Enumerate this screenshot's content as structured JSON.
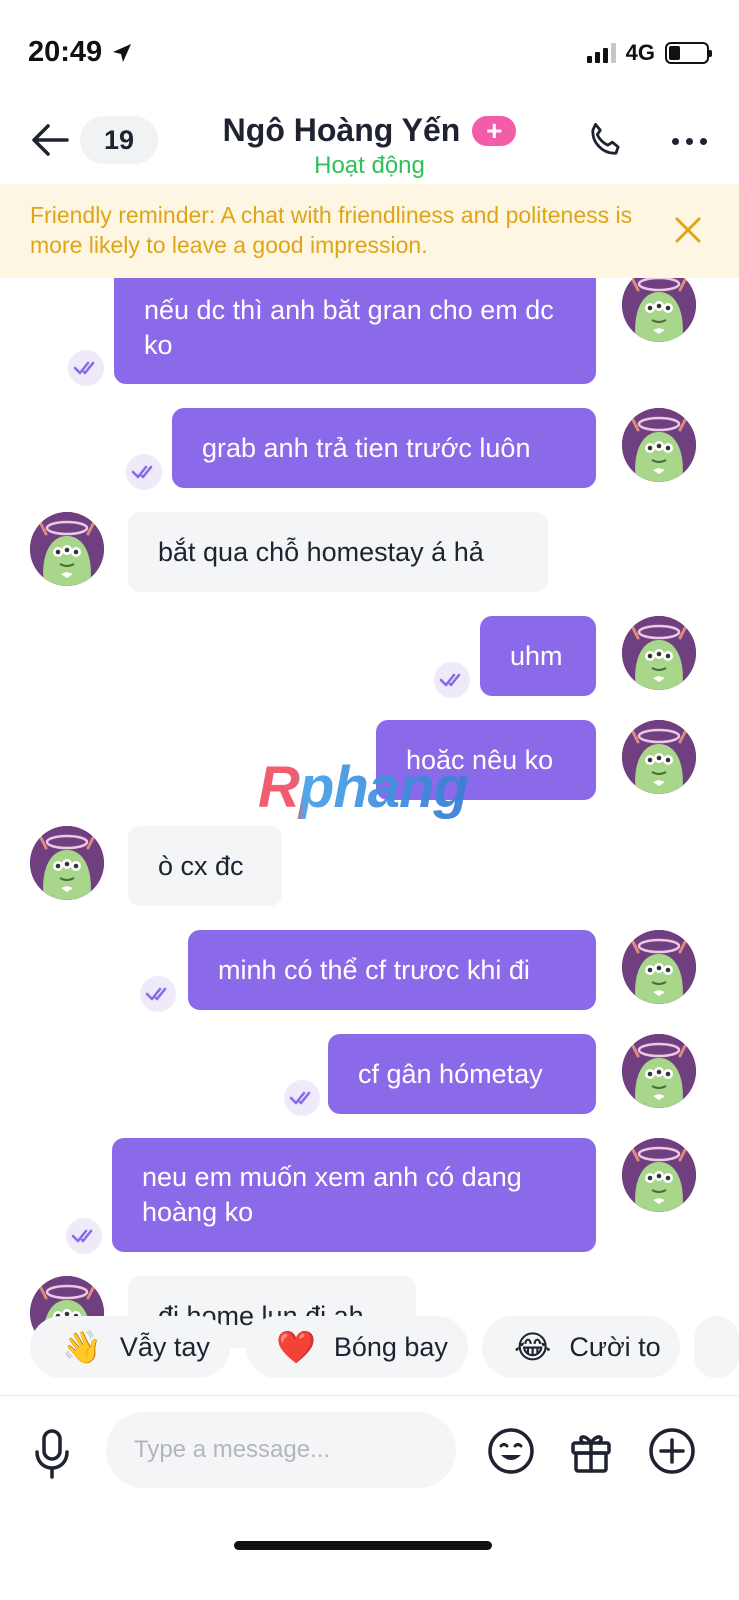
{
  "status_bar": {
    "time": "20:49",
    "network": "4G",
    "battery_level": 0.3
  },
  "header": {
    "back_icon": "arrow-left-icon",
    "unread_count": "19",
    "contact_name": "Ngô Hoàng Yến",
    "plus_badge": "+",
    "contact_status": "Hoạt động",
    "call_icon": "phone-icon",
    "more_icon": "more-dots-icon"
  },
  "reminder": {
    "text": "Friendly reminder: A chat with friendliness and politeness is more likely to leave a good impression.",
    "close_icon": "close-icon",
    "color": "#e0a516"
  },
  "messages": [
    {
      "direction": "out",
      "text": "nếu dc thì anh băt gran cho em dc ko",
      "read": true
    },
    {
      "direction": "out",
      "text": "grab anh trả tien trước luôn",
      "read": true
    },
    {
      "direction": "in",
      "text": "bắt qua chỗ homestay á hả"
    },
    {
      "direction": "out",
      "text": "uhm",
      "read": true
    },
    {
      "direction": "out",
      "text": "hoăc nêu ko",
      "read": true
    },
    {
      "direction": "in",
      "text": "ò cx đc"
    },
    {
      "direction": "out",
      "text": "minh có thể cf trươc khi đi",
      "read": true
    },
    {
      "direction": "out",
      "text": "cf gân hómetay",
      "read": true
    },
    {
      "direction": "out",
      "text": "neu em muốn xem anh có dang hoàng ko",
      "read": true
    },
    {
      "direction": "in",
      "text": "đi home lun đi ah"
    }
  ],
  "watermark": "Rphang",
  "quick_reactions": [
    {
      "emoji": "👋",
      "label": "Vẫy tay"
    },
    {
      "emoji": "❤️",
      "label": "Bóng bay"
    },
    {
      "emoji": "😂",
      "label": "Cười to"
    }
  ],
  "composer": {
    "placeholder": "Type a message...",
    "mic_icon": "microphone-icon",
    "emoji_icon": "smiley-icon",
    "gift_icon": "gift-icon",
    "add_icon": "plus-circle-icon"
  },
  "colors": {
    "outgoing_bubble": "#8a6ae9",
    "incoming_bubble": "#f4f5f7",
    "online_status": "#2fc05a",
    "plus_badge": "#f25ca8"
  }
}
